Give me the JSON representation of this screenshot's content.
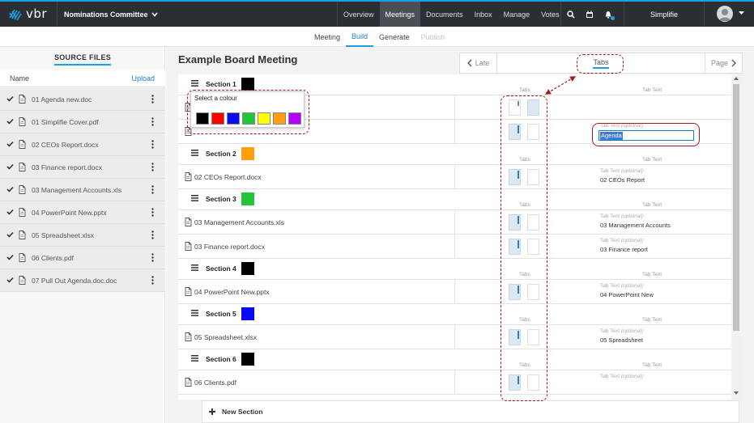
{
  "topbar": {
    "logo_text": "vbr",
    "committee": "Nominations Committee",
    "nav": [
      "Overview",
      "Meetings",
      "Documents",
      "Inbox",
      "Manage",
      "Votes"
    ],
    "active_nav": "Meetings",
    "user_name": "Simplifie",
    "icons": [
      "search-icon",
      "calendar-icon",
      "bell-icon"
    ]
  },
  "subnav": {
    "items": [
      "Meeting",
      "Build",
      "Generate",
      "Publish"
    ],
    "active": "Build",
    "disabled": "Publish"
  },
  "left": {
    "title": "SOURCE FILES",
    "name_header": "Name",
    "upload_label": "Upload",
    "files": [
      "01 Agenda new.doc",
      "01 Simplifie Cover.pdf",
      "02 CEOs Report.docx",
      "03 Finance report.docx",
      "03 Management Accounts.xls",
      "04 PowerPoint New.pptx",
      "05 Spreadsheet.xlsx",
      "06 Clients.pdf",
      "07 Pull Out Agenda.doc.doc"
    ]
  },
  "main": {
    "title": "Example Board Meeting",
    "pager_prev": "Late",
    "pager_mid": "Tabs",
    "pager_next": "Page",
    "tabs_header": "Tabs",
    "tabtext_header": "Tab Text",
    "tab_text_label": "Tab Text",
    "tab_text_optional": "(optional)",
    "selected_input_value": "Agenda",
    "new_section_label": "New Section"
  },
  "sections": [
    {
      "label": "Section 1",
      "color": "#000000"
    },
    {
      "label": "Section 2",
      "color": "#ff9f0d"
    },
    {
      "label": "Section 3",
      "color": "#22c43a"
    },
    {
      "label": "Section 4",
      "color": "#000000"
    },
    {
      "label": "Section 5",
      "color": "#0a0af5"
    },
    {
      "label": "Section 6",
      "color": "#000000"
    }
  ],
  "docs": [
    {
      "name": "02 CEOs Report.docx",
      "tab_text": "02 CEOs Report"
    },
    {
      "name": "03 Management Accounts.xls",
      "tab_text": "03 Management Accounts"
    },
    {
      "name": "03 Finance report.docx",
      "tab_text": "03 Finance report"
    },
    {
      "name": "04 PowerPoint New.pptx",
      "tab_text": "04 PowerPoint New"
    },
    {
      "name": "05 Spreadsheet.xlsx",
      "tab_text": "05 Spreadsheet"
    },
    {
      "name": "06 Clients.pdf",
      "tab_text": ""
    }
  ],
  "colour_popup": {
    "title": "Select a colour",
    "colors": [
      "#000000",
      "#ff0000",
      "#0a0af5",
      "#22c43a",
      "#ffff00",
      "#ff9f0d",
      "#b300ff"
    ]
  }
}
